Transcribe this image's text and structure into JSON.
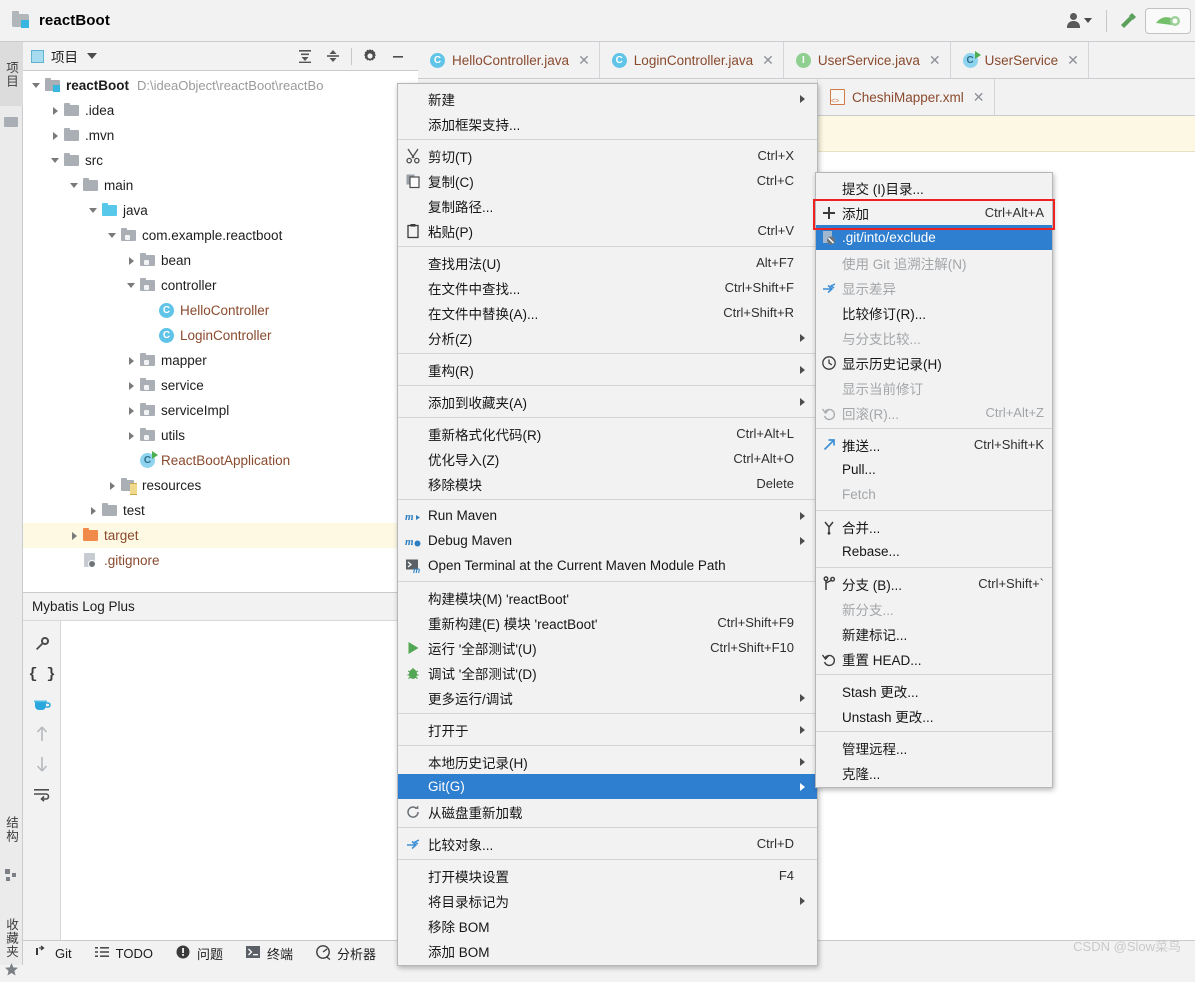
{
  "titlebar": {
    "project_name": "reactBoot",
    "icons": [
      "project-icon",
      "account-icon",
      "chevron-down-icon",
      "build-hammer-icon",
      "run-icon"
    ]
  },
  "left_strip": {
    "tabs": [
      {
        "label": "项目",
        "selected": true
      },
      {
        "label": "结构",
        "selected": false
      },
      {
        "label": "收藏夹",
        "selected": false
      }
    ]
  },
  "project_panel": {
    "title": "项目",
    "toolbar": [
      "expand-all-icon",
      "collapse-all-icon",
      "gear-icon",
      "minimize-icon"
    ],
    "tree": [
      {
        "label": "reactBoot",
        "path": "D:\\ideaObject\\reactBoot\\reactBo",
        "depth": 0,
        "arrow": "down",
        "icon": "module-folder-icon",
        "bold": true
      },
      {
        "label": ".idea",
        "path": "",
        "depth": 1,
        "arrow": "right",
        "icon": "folder-icon",
        "bold": false
      },
      {
        "label": ".mvn",
        "path": "",
        "depth": 1,
        "arrow": "right",
        "icon": "folder-icon",
        "bold": false
      },
      {
        "label": "src",
        "path": "",
        "depth": 1,
        "arrow": "down",
        "icon": "folder-icon",
        "bold": false
      },
      {
        "label": "main",
        "path": "",
        "depth": 2,
        "arrow": "down",
        "icon": "folder-icon",
        "bold": false
      },
      {
        "label": "java",
        "path": "",
        "depth": 3,
        "arrow": "down",
        "icon": "source-folder-icon",
        "bold": false
      },
      {
        "label": "com.example.reactboot",
        "path": "",
        "depth": 4,
        "arrow": "down",
        "icon": "package-icon",
        "bold": false
      },
      {
        "label": "bean",
        "path": "",
        "depth": 5,
        "arrow": "right",
        "icon": "package-icon",
        "bold": false
      },
      {
        "label": "controller",
        "path": "",
        "depth": 5,
        "arrow": "down",
        "icon": "package-icon",
        "bold": false
      },
      {
        "label": "HelloController",
        "path": "",
        "depth": 6,
        "arrow": "none",
        "icon": "java-class-icon",
        "bold": false
      },
      {
        "label": "LoginController",
        "path": "",
        "depth": 6,
        "arrow": "none",
        "icon": "java-class-icon",
        "bold": false
      },
      {
        "label": "mapper",
        "path": "",
        "depth": 5,
        "arrow": "right",
        "icon": "package-icon",
        "bold": false
      },
      {
        "label": "service",
        "path": "",
        "depth": 5,
        "arrow": "right",
        "icon": "package-icon",
        "bold": false
      },
      {
        "label": "serviceImpl",
        "path": "",
        "depth": 5,
        "arrow": "right",
        "icon": "package-icon",
        "bold": false
      },
      {
        "label": "utils",
        "path": "",
        "depth": 5,
        "arrow": "right",
        "icon": "package-icon",
        "bold": false
      },
      {
        "label": "ReactBootApplication",
        "path": "",
        "depth": 5,
        "arrow": "none",
        "icon": "spring-boot-app-icon",
        "bold": false
      },
      {
        "label": "resources",
        "path": "",
        "depth": 4,
        "arrow": "right",
        "icon": "resources-folder-icon",
        "bold": false
      },
      {
        "label": "test",
        "path": "",
        "depth": 3,
        "arrow": "right",
        "icon": "folder-icon",
        "bold": false
      },
      {
        "label": "target",
        "path": "",
        "depth": 2,
        "arrow": "right",
        "icon": "excluded-folder-icon",
        "bold": false,
        "highlight": true
      },
      {
        "label": ".gitignore",
        "path": "",
        "depth": 2,
        "arrow": "none",
        "icon": "gitignore-file-icon",
        "bold": false
      }
    ]
  },
  "mybatis_panel": {
    "title": "Mybatis Log Plus",
    "tool_icons": [
      "wrench-icon",
      "braces-icon",
      "coffee-icon",
      "arrow-up-icon",
      "arrow-down-icon",
      "wrap-text-icon"
    ]
  },
  "editor": {
    "tabs_row1": [
      {
        "label": "HelloController.java",
        "icon": "java-class-icon"
      },
      {
        "label": "LoginController.java",
        "icon": "java-class-icon"
      },
      {
        "label": "UserService.java",
        "icon": "java-interface-icon"
      },
      {
        "label": "UserService",
        "icon": "spring-boot-app-icon"
      }
    ],
    "tabs_row2": [
      {
        "label": "CheshiMapper.xml",
        "icon": "xml-file-icon"
      }
    ]
  },
  "context_menu": {
    "items": [
      {
        "label": "新建",
        "icon": "",
        "key": "",
        "submenu": true
      },
      {
        "label": "添加框架支持...",
        "icon": "",
        "key": "",
        "submenu": false
      },
      {
        "sep": true
      },
      {
        "label": "剪切(T)",
        "icon": "cut-icon",
        "key": "Ctrl+X",
        "submenu": false,
        "mnemonic": "T"
      },
      {
        "label": "复制(C)",
        "icon": "copy-icon",
        "key": "Ctrl+C",
        "submenu": false,
        "mnemonic": "C"
      },
      {
        "label": "复制路径...",
        "icon": "",
        "key": "",
        "submenu": false
      },
      {
        "label": "粘贴(P)",
        "icon": "paste-icon",
        "key": "Ctrl+V",
        "submenu": false,
        "mnemonic": "P"
      },
      {
        "sep": true
      },
      {
        "label": "查找用法(U)",
        "icon": "",
        "key": "Alt+F7",
        "submenu": false,
        "mnemonic": "U"
      },
      {
        "label": "在文件中查找...",
        "icon": "",
        "key": "Ctrl+Shift+F",
        "submenu": false
      },
      {
        "label": "在文件中替换(A)...",
        "icon": "",
        "key": "Ctrl+Shift+R",
        "submenu": false,
        "mnemonic": "A"
      },
      {
        "label": "分析(Z)",
        "icon": "",
        "key": "",
        "submenu": true,
        "mnemonic": "Z"
      },
      {
        "sep": true
      },
      {
        "label": "重构(R)",
        "icon": "",
        "key": "",
        "submenu": true,
        "mnemonic": "R"
      },
      {
        "sep": true
      },
      {
        "label": "添加到收藏夹(A)",
        "icon": "",
        "key": "",
        "submenu": true,
        "mnemonic": "A"
      },
      {
        "sep": true
      },
      {
        "label": "重新格式化代码(R)",
        "icon": "",
        "key": "Ctrl+Alt+L",
        "submenu": false,
        "mnemonic": "R"
      },
      {
        "label": "优化导入(Z)",
        "icon": "",
        "key": "Ctrl+Alt+O",
        "submenu": false,
        "mnemonic": "Z"
      },
      {
        "label": "移除模块",
        "icon": "",
        "key": "Delete",
        "submenu": false
      },
      {
        "sep": true
      },
      {
        "label": "Run Maven",
        "icon": "maven-run-icon",
        "key": "",
        "submenu": true
      },
      {
        "label": "Debug Maven",
        "icon": "maven-debug-icon",
        "key": "",
        "submenu": true
      },
      {
        "label": "Open Terminal at the Current Maven Module Path",
        "icon": "terminal-maven-icon",
        "key": "",
        "submenu": false
      },
      {
        "sep": true
      },
      {
        "label": "构建模块(M) 'reactBoot'",
        "icon": "",
        "key": "",
        "submenu": false,
        "mnemonic": "M"
      },
      {
        "label": "重新构建(E) 模块 'reactBoot'",
        "icon": "",
        "key": "Ctrl+Shift+F9",
        "submenu": false,
        "mnemonic": "E"
      },
      {
        "label": "运行 '全部测试'(U)",
        "icon": "run-green-icon",
        "key": "Ctrl+Shift+F10",
        "submenu": false
      },
      {
        "label": "调试 '全部测试'(D)",
        "icon": "debug-bug-icon",
        "key": "",
        "submenu": false
      },
      {
        "label": "更多运行/调试",
        "icon": "",
        "key": "",
        "submenu": true
      },
      {
        "sep": true
      },
      {
        "label": "打开于",
        "icon": "",
        "key": "",
        "submenu": true
      },
      {
        "sep": true
      },
      {
        "label": "本地历史记录(H)",
        "icon": "",
        "key": "",
        "submenu": true,
        "mnemonic": "H"
      },
      {
        "label": "Git(G)",
        "icon": "",
        "key": "",
        "submenu": true,
        "selected": true,
        "mnemonic": "G"
      },
      {
        "label": "从磁盘重新加载",
        "icon": "refresh-icon",
        "key": "",
        "submenu": false
      },
      {
        "sep": true
      },
      {
        "label": "比较对象...",
        "icon": "compare-icon",
        "key": "Ctrl+D",
        "submenu": false
      },
      {
        "sep": true
      },
      {
        "label": "打开模块设置",
        "icon": "",
        "key": "F4",
        "submenu": false
      },
      {
        "label": "将目录标记为",
        "icon": "",
        "key": "",
        "submenu": true
      },
      {
        "label": "移除 BOM",
        "icon": "",
        "key": "",
        "submenu": false
      },
      {
        "label": "添加 BOM",
        "icon": "",
        "key": "",
        "submenu": false
      }
    ]
  },
  "git_submenu": {
    "items": [
      {
        "label": "提交 (I)目录...",
        "icon": "",
        "key": "",
        "disabled": false
      },
      {
        "label": "添加",
        "icon": "plus-icon",
        "key": "Ctrl+Alt+A",
        "disabled": false,
        "highlighted_red": true
      },
      {
        "label": ".git/into/exclude",
        "icon": "gitignore-file-icon",
        "key": "",
        "disabled": false,
        "selected": true
      },
      {
        "label": "使用 Git 追溯注解(N)",
        "icon": "",
        "key": "",
        "disabled": true
      },
      {
        "label": "显示差异",
        "icon": "compare-icon",
        "key": "",
        "disabled": true
      },
      {
        "label": "比较修订(R)...",
        "icon": "",
        "key": "",
        "disabled": false
      },
      {
        "label": "与分支比较...",
        "icon": "",
        "key": "",
        "disabled": true
      },
      {
        "label": "显示历史记录(H)",
        "icon": "history-clock-icon",
        "key": "",
        "disabled": false
      },
      {
        "label": "显示当前修订",
        "icon": "",
        "key": "",
        "disabled": true
      },
      {
        "label": "回滚(R)...",
        "icon": "revert-icon",
        "key": "Ctrl+Alt+Z",
        "disabled": true
      },
      {
        "sep": true
      },
      {
        "label": "推送...",
        "icon": "push-arrow-icon",
        "key": "Ctrl+Shift+K",
        "disabled": false
      },
      {
        "label": "Pull...",
        "icon": "",
        "key": "",
        "disabled": false
      },
      {
        "label": "Fetch",
        "icon": "",
        "key": "",
        "disabled": true
      },
      {
        "sep": true
      },
      {
        "label": "合并...",
        "icon": "merge-icon",
        "key": "",
        "disabled": false
      },
      {
        "label": "Rebase...",
        "icon": "",
        "key": "",
        "disabled": false
      },
      {
        "sep": true
      },
      {
        "label": "分支 (B)...",
        "icon": "branch-icon",
        "key": "Ctrl+Shift+`",
        "disabled": false
      },
      {
        "label": "新分支...",
        "icon": "",
        "key": "",
        "disabled": true
      },
      {
        "label": "新建标记...",
        "icon": "",
        "key": "",
        "disabled": false
      },
      {
        "label": "重置 HEAD...",
        "icon": "reset-icon",
        "key": "",
        "disabled": false
      },
      {
        "sep": true
      },
      {
        "label": "Stash 更改...",
        "icon": "",
        "key": "",
        "disabled": false
      },
      {
        "label": "Unstash 更改...",
        "icon": "",
        "key": "",
        "disabled": false
      },
      {
        "sep": true
      },
      {
        "label": "管理远程...",
        "icon": "",
        "key": "",
        "disabled": false
      },
      {
        "label": "克隆...",
        "icon": "",
        "key": "",
        "disabled": false
      }
    ]
  },
  "status_bar": {
    "items": [
      {
        "label": "Git",
        "icon": "git-icon"
      },
      {
        "label": "TODO",
        "icon": "todo-icon"
      },
      {
        "label": "问题",
        "icon": "problems-icon"
      },
      {
        "label": "终端",
        "icon": "terminal-icon"
      },
      {
        "label": "分析器",
        "icon": "profiler-icon"
      }
    ]
  },
  "watermark": {
    "text": "CSDN @Slow菜鸟"
  },
  "colors": {
    "selection_blue": "#2f7fd0",
    "highlight_red": "#ee2222",
    "tab_text": "#8a4a2e",
    "notification_band": "#fdf8e3",
    "target_row": "#fdf9e2"
  }
}
